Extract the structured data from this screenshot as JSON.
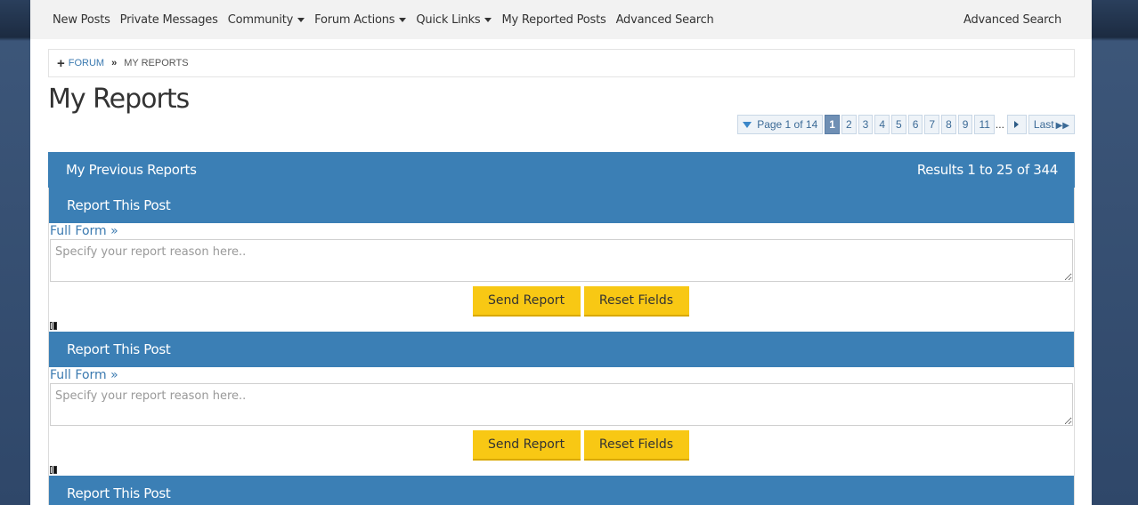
{
  "navbar": {
    "items": [
      {
        "label": "New Posts",
        "dropdown": false
      },
      {
        "label": "Private Messages",
        "dropdown": false
      },
      {
        "label": "Community",
        "dropdown": true
      },
      {
        "label": "Forum Actions",
        "dropdown": true
      },
      {
        "label": "Quick Links",
        "dropdown": true
      },
      {
        "label": "My Reported Posts",
        "dropdown": false
      },
      {
        "label": "Advanced Search",
        "dropdown": false
      }
    ],
    "right_link": "Advanced Search"
  },
  "breadcrumb": {
    "root": "FORUM",
    "current": "MY REPORTS"
  },
  "page_title": "My Reports",
  "pagination": {
    "page_label": "Page 1 of 14",
    "current": "1",
    "pages": [
      "2",
      "3",
      "4",
      "5",
      "6",
      "7",
      "8",
      "9",
      "11"
    ],
    "ellipsis": "...",
    "last_label": "Last"
  },
  "section": {
    "title": "My Previous Reports",
    "results": "Results 1 to 25 of 344"
  },
  "reports": [
    {
      "title": "Report This Post",
      "full_form": "Full Form »",
      "placeholder": "Specify your report reason here..",
      "send": "Send Report",
      "reset": "Reset Fields"
    },
    {
      "title": "Report This Post",
      "full_form": "Full Form »",
      "placeholder": "Specify your report reason here..",
      "send": "Send Report",
      "reset": "Reset Fields"
    },
    {
      "title": "Report This Post"
    }
  ],
  "colors": {
    "header_blue": "#3b7fb5",
    "button_yellow": "#f8c814",
    "link_blue": "#3b7ab0"
  }
}
